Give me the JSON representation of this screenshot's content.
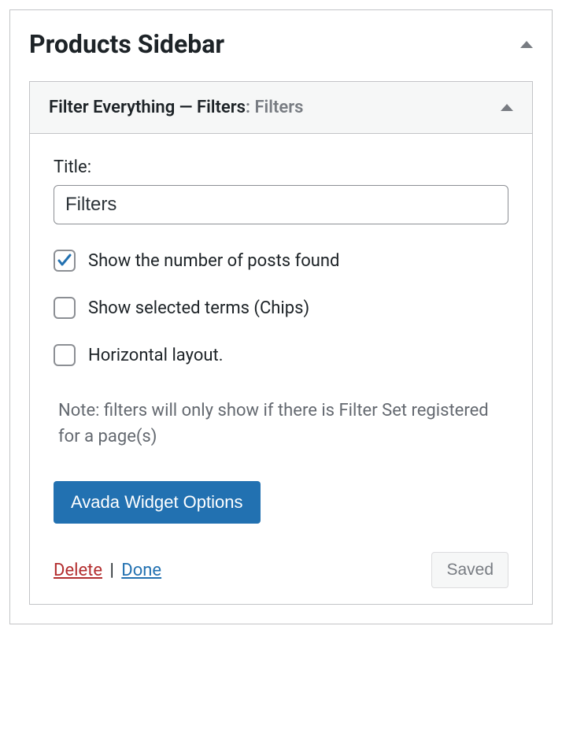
{
  "sidebar": {
    "title": "Products Sidebar"
  },
  "widget": {
    "header_main": "Filter Everything — Filters",
    "header_sub": ": Filters",
    "title_field_label": "Title:",
    "title_value": "Filters",
    "checkboxes": {
      "posts_found": {
        "label": "Show the number of posts found",
        "checked": true
      },
      "chips": {
        "label": "Show selected terms (Chips)",
        "checked": false
      },
      "horizontal": {
        "label": "Horizontal layout.",
        "checked": false
      }
    },
    "note": "Note: filters will only show if there is Filter Set registered for a page(s)",
    "options_button": "Avada Widget Options",
    "delete_link": "Delete",
    "done_link": "Done",
    "saved_button": "Saved"
  }
}
